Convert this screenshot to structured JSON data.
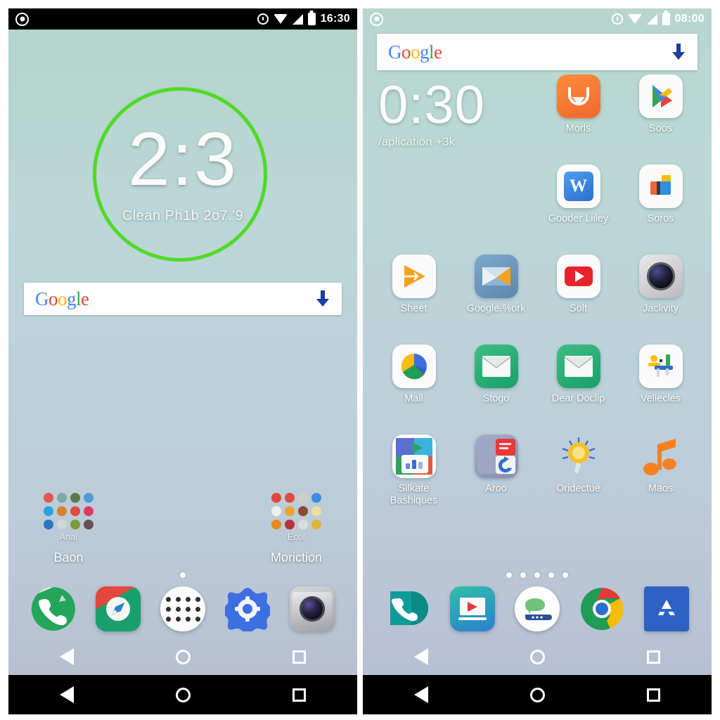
{
  "left_phone": {
    "status_bar": {
      "time": "16:30",
      "icons": [
        "target-icon",
        "alarm-icon",
        "wifi-icon",
        "signal-icon",
        "battery-icon"
      ]
    },
    "clock_widget": {
      "time": "2:3",
      "subtitle": "Clean Ph1b 2o7.'9",
      "ring_color": "#4fdb24"
    },
    "search": {
      "logo": "Google",
      "placeholder": "",
      "value": "",
      "action_icon": "download-arrow-icon"
    },
    "folders": [
      {
        "name": "Baon",
        "sub_label": "Anal"
      },
      {
        "name": "Moriction",
        "sub_label": "Ecol"
      }
    ],
    "page_dots": 1,
    "dock": [
      {
        "label": "phone",
        "icon": "phone-icon"
      },
      {
        "label": "browser",
        "icon": "compass-browser-icon"
      },
      {
        "label": "app drawer",
        "icon": "app-drawer-icon"
      },
      {
        "label": "settings",
        "icon": "gear-icon"
      },
      {
        "label": "camera",
        "icon": "camera-icon"
      }
    ],
    "nav": [
      "back-icon",
      "home-icon",
      "recents-icon"
    ]
  },
  "right_phone": {
    "status_bar": {
      "time": "08:00",
      "icons": [
        "target-icon",
        "alarm-icon",
        "wifi-icon",
        "signal-icon",
        "battery-icon"
      ]
    },
    "search": {
      "logo": "Google",
      "placeholder": "",
      "value": "",
      "action_icon": "download-arrow-icon"
    },
    "clock_widget": {
      "time": "0:30",
      "subtitle": "/aplication +3k"
    },
    "apps": [
      {
        "label": "",
        "icon": "none",
        "empty": true
      },
      {
        "label": "",
        "icon": "none",
        "empty": true
      },
      {
        "label": "Morls",
        "icon": "shopping-bag-icon"
      },
      {
        "label": "Soos",
        "icon": "play-store-icon"
      },
      {
        "label": "",
        "icon": "none",
        "empty": true
      },
      {
        "label": "",
        "icon": "none",
        "empty": true
      },
      {
        "label": "Gooder Liiley",
        "icon": "wps-writer-icon"
      },
      {
        "label": "Soros",
        "icon": "blocks-icon"
      },
      {
        "label": "Sheet",
        "icon": "send-play-icon"
      },
      {
        "label": "Google.%ork",
        "icon": "google-work-icon"
      },
      {
        "label": "Solt",
        "icon": "youtube-icon"
      },
      {
        "label": "Jaclivity",
        "icon": "camera-lens-icon"
      },
      {
        "label": "Mall",
        "icon": "mail-circle-icon"
      },
      {
        "label": "Stogo",
        "icon": "envelope-icon"
      },
      {
        "label": "Dear Doclip",
        "icon": "envelope-icon"
      },
      {
        "label": "Vellecles",
        "icon": "chart-sliders-icon"
      },
      {
        "label": "Silkate Bashiques",
        "icon": "slides-icon"
      },
      {
        "label": "Aroo",
        "icon": "pdf-reader-icon"
      },
      {
        "label": "Oridectue",
        "icon": "sun-icon"
      },
      {
        "label": "Maos",
        "icon": "music-note-icon"
      }
    ],
    "page_dots": 5,
    "dock": [
      {
        "label": "phone",
        "icon": "phone-teal-icon"
      },
      {
        "label": "media",
        "icon": "media-player-icon"
      },
      {
        "label": "assistant",
        "icon": "assistant-icon"
      },
      {
        "label": "chrome",
        "icon": "chrome-icon"
      },
      {
        "label": "app store",
        "icon": "app-store-icon"
      }
    ],
    "nav": [
      "back-icon",
      "home-icon",
      "recents-icon"
    ]
  },
  "colors": {
    "ring_green": "#4fdb24",
    "google_blue": "#4285F4",
    "google_red": "#EA4335",
    "google_yellow": "#FBBC05",
    "google_green": "#34A853",
    "status_bar_dark": "#000000",
    "nav_bar_black": "#000000"
  }
}
